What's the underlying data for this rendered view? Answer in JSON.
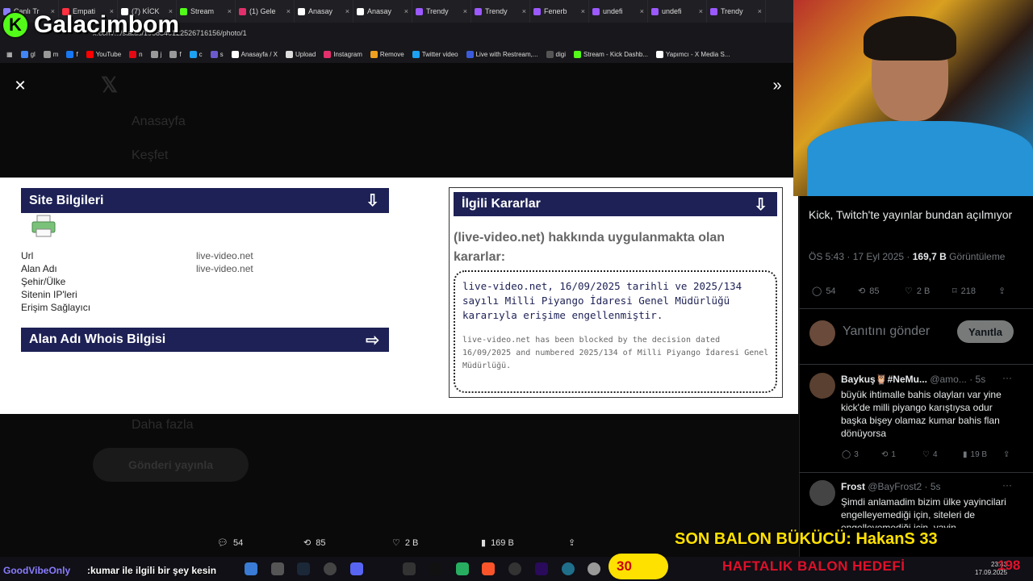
{
  "browser": {
    "tabs": [
      {
        "label": "Canlı Tr",
        "color": "#8a7cff"
      },
      {
        "label": "Empati",
        "color": "#ff3040"
      },
      {
        "label": "(7) KİCK",
        "color": "#ffffff"
      },
      {
        "label": "Stream",
        "color": "#53fc18"
      },
      {
        "label": "(1) Gele",
        "color": "#e1306c"
      },
      {
        "label": "Anasay",
        "color": "#ffffff"
      },
      {
        "label": "Anasay",
        "color": "#ffffff"
      },
      {
        "label": "Trendy",
        "color": "#9b59ff"
      },
      {
        "label": "Trendy",
        "color": "#9b59ff"
      },
      {
        "label": "Fenerb",
        "color": "#9b59ff"
      },
      {
        "label": "undefi",
        "color": "#9b59ff"
      },
      {
        "label": "undefi",
        "color": "#9b59ff"
      },
      {
        "label": "Trendy",
        "color": "#9b59ff"
      }
    ],
    "url": "x.com/.../status/1968340122526716156/photo/1",
    "bookmarks": [
      {
        "label": "gl",
        "color": "#4285f4"
      },
      {
        "label": "m",
        "color": "#999999"
      },
      {
        "label": "f",
        "color": "#1877f2"
      },
      {
        "label": "YouTube",
        "color": "#ff0000"
      },
      {
        "label": "n",
        "color": "#e50914"
      },
      {
        "label": "j",
        "color": "#999999"
      },
      {
        "label": "f",
        "color": "#999999"
      },
      {
        "label": "c",
        "color": "#1da1f2"
      },
      {
        "label": "s",
        "color": "#6a5acd"
      },
      {
        "label": "Anasayfa / X",
        "color": "#ffffff"
      },
      {
        "label": "Upload",
        "color": "#dddddd"
      },
      {
        "label": "Instagram",
        "color": "#e1306c"
      },
      {
        "label": "Remove",
        "color": "#f0a020"
      },
      {
        "label": "Twitter video",
        "color": "#1da1f2"
      },
      {
        "label": "Live with Restream,...",
        "color": "#3b5bdb"
      },
      {
        "label": "digi",
        "color": "#555555"
      },
      {
        "label": "Stream - Kick Dashb...",
        "color": "#53fc18"
      },
      {
        "label": "Yapımcı - X Media S...",
        "color": "#ffffff"
      }
    ]
  },
  "logo": {
    "text": "Galacimbom",
    "mark": "K"
  },
  "background_nav": {
    "home": "Anasayfa",
    "explore": "Keşfet",
    "more": "Daha fazla",
    "post": "Gönderi yayınla"
  },
  "photo": {
    "site_info_title": "Site Bilgileri",
    "site_info_arrow": "⇩",
    "labels": [
      "Url",
      "Alan Adı",
      "Şehir/Ülke",
      "Sitenin IP'leri",
      "Erişim Sağlayıcı"
    ],
    "values": [
      "live-video.net",
      "live-video.net"
    ],
    "whois_title": "Alan Adı Whois Bilgisi",
    "whois_arrow": "⇨",
    "decisions_title": "İlgili Kararlar",
    "decisions_arrow": "⇩",
    "decisions_heading": "(live-video.net) hakkında uygulanmakta olan kararlar:",
    "decision_tr": "live-video.net, 16/09/2025 tarihli ve 2025/134 sayılı Milli Piyango İdaresi Genel Müdürlüğü kararıyla erişime engellenmiştir.",
    "decision_en": "live-video.net has been blocked by the decision dated 16/09/2025 and numbered 2025/134 of Milli Piyango İdaresi Genel Müdürlüğü."
  },
  "photo_actions": {
    "replies": "54",
    "reposts": "85",
    "likes": "2 B",
    "views": "169 B"
  },
  "post": {
    "text": "Kick, Twitch'te yayınlar bundan açılmıyor",
    "time": "ÖS 5:43 · 17 Eyl 2025 · ",
    "views": "169,7 B",
    "views_label": " Görüntüleme",
    "stats": {
      "replies": "54",
      "reposts": "85",
      "likes": "2 B",
      "bookmarks": "218"
    },
    "reply_placeholder": "Yanıtını gönder",
    "reply_button": "Yanıtla"
  },
  "comments": [
    {
      "name": "Baykuş🦉#NeMu...",
      "handle": "@amo... · 5s",
      "text": "büyük ihtimalle bahis olayları var yine kick'de milli piyango karıştıysa odur başka bişey olamaz kumar bahis flan dönüyorsa",
      "replies": "3",
      "reposts": "1",
      "likes": "4",
      "views": "19 B",
      "avatar_color": "#5a4030"
    },
    {
      "name": "Frost",
      "handle": "@BayFrost2 · 5s",
      "text": "Şimdi anlamadim bizim ülke yayincilari engelleyemediği için, siteleri de engelleyemediği için, yayin",
      "avatar_color": "#444444"
    }
  ],
  "overlay": {
    "balon_bucucu_prefix": "SON BALON BÜKÜCÜ: ",
    "balon_bucucu_name": "HakanS",
    "balon_bucucu_count": " 33",
    "chat_user": "GoodVibeOnly",
    "chat_message": ":kumar ile ilgili bir şey kesin",
    "goal_current": "30",
    "goal_label": "HAFTALIK BALON HEDEFİ",
    "goal_target": "198",
    "clock_time": "23:43",
    "clock_date": "17.09.2025"
  }
}
